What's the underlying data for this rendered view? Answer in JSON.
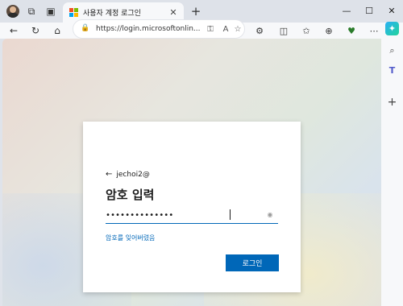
{
  "tab": {
    "title": "사용자 계정 로그인",
    "close": "✕"
  },
  "titlebar": {
    "new_tab": "+",
    "minimize": "—",
    "maximize": "☐",
    "close": "✕"
  },
  "toolbar": {
    "back": "←",
    "refresh": "↻",
    "home": "⌂"
  },
  "address": {
    "lock": "🔒",
    "url": "https://login.microsoftonlin..."
  },
  "login": {
    "back_arrow": "←",
    "account": "jechoi2@",
    "title": "암호 입력",
    "password_value": "••••••••••••••",
    "forgot_link": "암호를 잊어버렸음",
    "signin_button": "로그인"
  },
  "colors": {
    "accent": "#0067b8",
    "ms_red": "#f25022",
    "ms_green": "#7fba00",
    "ms_blue": "#00a4ef",
    "ms_yellow": "#ffb900"
  },
  "icons": {
    "titlebar": [
      "avatar",
      "workspaces-icon",
      "tab-actions-icon"
    ],
    "address_bar": [
      "key-icon",
      "read-aloud-icon",
      "favorite-star-icon"
    ],
    "toolbar": [
      "extensions-icon",
      "split-screen-icon",
      "favorites-icon",
      "collections-icon",
      "performance-icon",
      "more-icon"
    ],
    "sidebar": [
      "copilot-icon",
      "search-icon",
      "teams-icon",
      "add-icon"
    ]
  }
}
